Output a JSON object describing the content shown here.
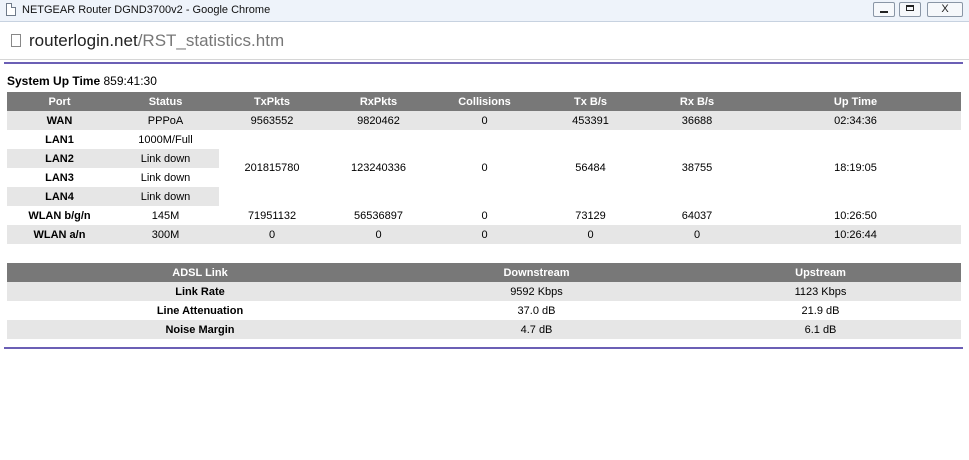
{
  "window": {
    "title": "NETGEAR Router DGND3700v2 - Google Chrome",
    "close_symbol": "X"
  },
  "address": {
    "host": "routerlogin.net",
    "path": "/RST_statistics.htm"
  },
  "system": {
    "uptime_label": "System Up Time",
    "uptime_value": "859:41:30"
  },
  "port_table": {
    "headers": [
      "Port",
      "Status",
      "TxPkts",
      "RxPkts",
      "Collisions",
      "Tx B/s",
      "Rx B/s",
      "Up Time"
    ],
    "wan": {
      "port": "WAN",
      "status": "PPPoA",
      "txpkts": "9563552",
      "rxpkts": "9820462",
      "collisions": "0",
      "txbs": "453391",
      "rxbs": "36688",
      "uptime": "02:34:36"
    },
    "lan": {
      "ports": [
        {
          "port": "LAN1",
          "status": "1000M/Full"
        },
        {
          "port": "LAN2",
          "status": "Link down"
        },
        {
          "port": "LAN3",
          "status": "Link down"
        },
        {
          "port": "LAN4",
          "status": "Link down"
        }
      ],
      "txpkts": "201815780",
      "rxpkts": "123240336",
      "collisions": "0",
      "txbs": "56484",
      "rxbs": "38755",
      "uptime": "18:19:05"
    },
    "wlan_bgn": {
      "port": "WLAN b/g/n",
      "status": "145M",
      "txpkts": "71951132",
      "rxpkts": "56536897",
      "collisions": "0",
      "txbs": "73129",
      "rxbs": "64037",
      "uptime": "10:26:50"
    },
    "wlan_an": {
      "port": "WLAN a/n",
      "status": "300M",
      "txpkts": "0",
      "rxpkts": "0",
      "collisions": "0",
      "txbs": "0",
      "rxbs": "0",
      "uptime": "10:26:44"
    }
  },
  "adsl_table": {
    "headers": [
      "ADSL Link",
      "Downstream",
      "Upstream"
    ],
    "rows": [
      {
        "label": "Link Rate",
        "down": "9592 Kbps",
        "up": "1123 Kbps"
      },
      {
        "label": "Line Attenuation",
        "down": "37.0 dB",
        "up": "21.9 dB"
      },
      {
        "label": "Noise Margin",
        "down": "4.7 dB",
        "up": "6.1 dB"
      }
    ]
  },
  "colors": {
    "header_bg": "#787878",
    "row_shade": "#e6e6e6",
    "rule": "#6b5fb5"
  }
}
